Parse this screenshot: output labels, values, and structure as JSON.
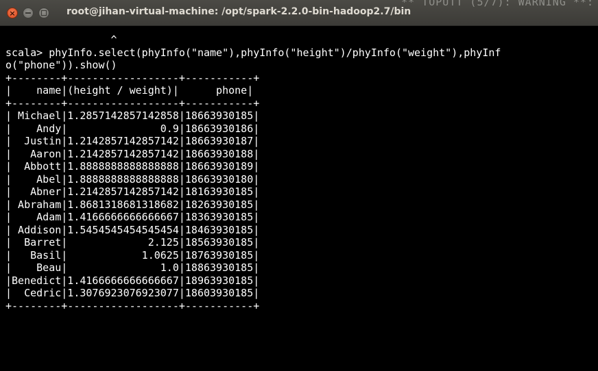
{
  "window": {
    "title": "root@jihan-virtual-machine: /opt/spark-2.2.0-bin-hadoop2.7/bin",
    "background_ghost_text": "** TOPUTT (5/7): WARNING **:",
    "close_glyph": "×"
  },
  "terminal": {
    "lines": [
      "                 ^",
      "",
      "scala> phyInfo.select(phyInfo(\"name\"),phyInfo(\"height\")/phyInfo(\"weight\"),phyInf",
      "o(\"phone\")).show()",
      "+--------+------------------+-----------+",
      "|    name|(height / weight)|      phone|",
      "+--------+------------------+-----------+",
      "| Michael|1.2857142857142858|18663930185|",
      "|    Andy|               0.9|18663930186|",
      "|  Justin|1.2142857142857142|18663930187|",
      "|   Aaron|1.2142857142857142|18663930188|",
      "|  Abbott|1.8888888888888888|18663930189|",
      "|    Abel|1.8888888888888888|18663930180|",
      "|   Abner|1.2142857142857142|18163930185|",
      "| Abraham|1.8681318681318682|18263930185|",
      "|    Adam|1.4166666666666667|18363930185|",
      "| Addison|1.5454545454545454|18463930185|",
      "|  Barret|             2.125|18563930185|",
      "|   Basil|            1.0625|18763930185|",
      "|    Beau|               1.0|18863930185|",
      "|Benedict|1.4166666666666667|18963930185|",
      "|  Cedric|1.3076923076923077|18603930185|",
      "+--------+------------------+-----------+",
      "",
      ""
    ]
  }
}
